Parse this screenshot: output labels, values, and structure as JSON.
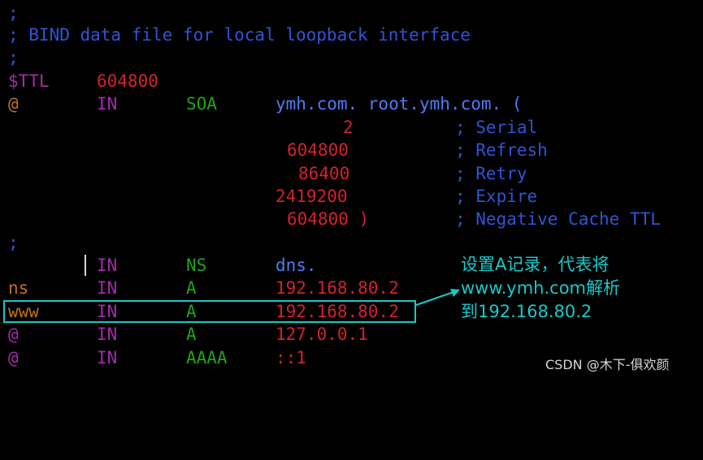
{
  "header_comments": [
    ";",
    "; BIND data file for local loopback interface",
    ";"
  ],
  "ttl": {
    "directive": "$TTL",
    "value": "604800"
  },
  "soa": {
    "name": "@",
    "class": "IN",
    "type": "SOA",
    "mname_rname": "ymh.com. root.ymh.com. (",
    "fields": [
      {
        "value": "2",
        "comment": "; Serial"
      },
      {
        "value": "604800",
        "comment": "; Refresh"
      },
      {
        "value": "86400",
        "comment": "; Retry"
      },
      {
        "value": "2419200",
        "comment": "; Expire"
      },
      {
        "value": "604800 )",
        "comment": "; Negative Cache TTL"
      }
    ]
  },
  "separator": ";",
  "records": [
    {
      "name": "",
      "class": "IN",
      "type": "NS",
      "data": "dns."
    },
    {
      "name": "ns",
      "class": "IN",
      "type": "A",
      "data": "192.168.80.2"
    },
    {
      "name": "www",
      "class": "IN",
      "type": "A",
      "data": "192.168.80.2"
    },
    {
      "name": "@",
      "class": "IN",
      "type": "A",
      "data": "127.0.0.1"
    },
    {
      "name": "@",
      "class": "IN",
      "type": "AAAA",
      "data": "::1"
    }
  ],
  "annotation": {
    "lines": [
      "设置A记录，代表将",
      "www.ymh.com解析",
      "到192.168.80.2"
    ]
  },
  "watermark": "CSDN @木下-俱欢颜",
  "colors": {
    "comment": "#2f54d6",
    "directive": "#a42ba8",
    "number": "#d3222b",
    "type": "#21a318",
    "owner": "#c1711a",
    "domain": "#4f7cf3",
    "annotation": "#19c9c9"
  }
}
